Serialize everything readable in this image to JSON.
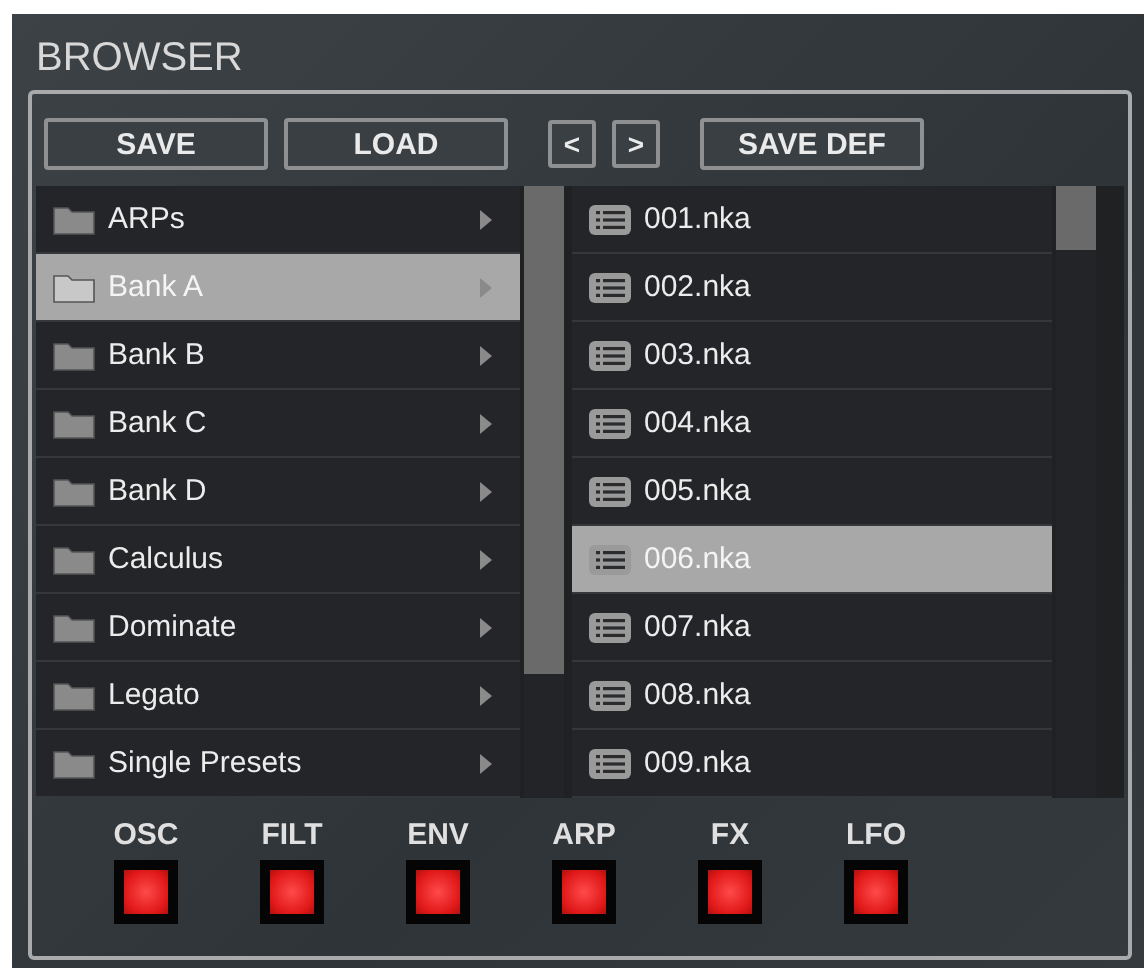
{
  "title": "BROWSER",
  "buttons": [
    {
      "label": "SAVE",
      "kind": "wide"
    },
    {
      "label": "LOAD",
      "kind": "wide"
    },
    {
      "label": "<",
      "kind": "small"
    },
    {
      "label": ">",
      "kind": "small"
    },
    {
      "label": "SAVE DEF",
      "kind": "wide"
    }
  ],
  "folders": [
    {
      "name": "ARPs",
      "selected": false
    },
    {
      "name": "Bank A",
      "selected": true
    },
    {
      "name": "Bank B",
      "selected": false
    },
    {
      "name": "Bank C",
      "selected": false
    },
    {
      "name": "Bank D",
      "selected": false
    },
    {
      "name": "Calculus",
      "selected": false
    },
    {
      "name": "Dominate",
      "selected": false
    },
    {
      "name": "Legato",
      "selected": false
    },
    {
      "name": "Single Presets",
      "selected": false
    }
  ],
  "files": [
    {
      "name": "001.nka",
      "selected": false
    },
    {
      "name": "002.nka",
      "selected": false
    },
    {
      "name": "003.nka",
      "selected": false
    },
    {
      "name": "004.nka",
      "selected": false
    },
    {
      "name": "005.nka",
      "selected": false
    },
    {
      "name": "006.nka",
      "selected": true
    },
    {
      "name": "007.nka",
      "selected": false
    },
    {
      "name": "008.nka",
      "selected": false
    },
    {
      "name": "009.nka",
      "selected": false
    }
  ],
  "switches": [
    {
      "label": "OSC",
      "on": true
    },
    {
      "label": "FILT",
      "on": true
    },
    {
      "label": "ENV",
      "on": true
    },
    {
      "label": "ARP",
      "on": true
    },
    {
      "label": "FX",
      "on": true
    },
    {
      "label": "LFO",
      "on": true
    }
  ]
}
